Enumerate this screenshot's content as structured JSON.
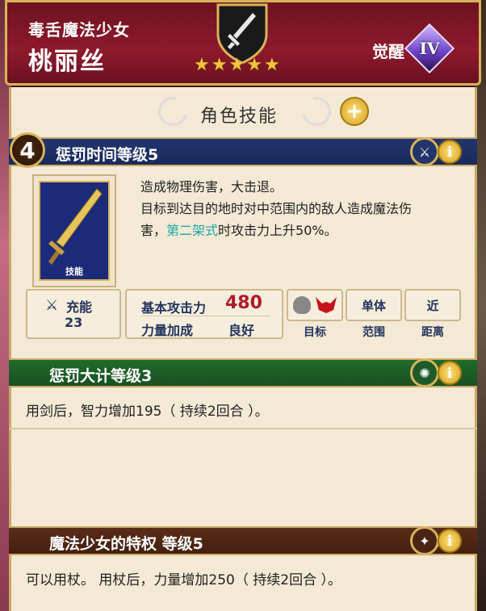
{
  "header": {
    "subtitle": "毒舌魔法少女",
    "name": "桃丽丝",
    "awaken_label": "觉醒",
    "awaken_rank": "IV",
    "star_count": 5,
    "class_icon": "sword-icon"
  },
  "panel": {
    "title": "角色技能"
  },
  "skill1": {
    "level": "4",
    "title": "惩罚时间等级5",
    "card_label": "技能",
    "desc_line1": "造成物理伤害，大击退。",
    "desc_line2": "目标到达目的地时对中范围内的敌人造成魔法伤",
    "desc_line3_pre": "害，",
    "desc_highlight": "第二架式",
    "desc_line3_post": "时攻击力上升50%。",
    "charge_label": "充能",
    "charge_value": "23",
    "base_atk_label": "基本攻击力",
    "base_atk_value": "480",
    "power_bonus_label": "力量加成",
    "power_bonus_value": "良好",
    "target_label": "目标",
    "range_value": "单体",
    "range_label": "范围",
    "distance_value": "近",
    "distance_label": "距离"
  },
  "skill2": {
    "title": "惩罚大计等级3",
    "desc": "用剑后，智力增加195（ 持续2回合 ）。"
  },
  "skill3": {
    "title": "魔法少女的特权 等级5",
    "desc": "可以用杖。 用杖后，力量增加250（ 持续2回合 ）。"
  },
  "colors": {
    "header_red": "#8e1a2c",
    "gold": "#d9b35a",
    "skill1_bar": "#21356e",
    "skill2_bar": "#1f6a2a",
    "skill3_bar": "#5a2c18",
    "highlight": "#1aa6a6",
    "atk_red": "#b01a2a"
  }
}
